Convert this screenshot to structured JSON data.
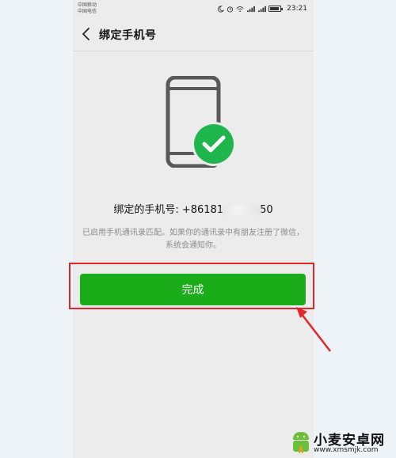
{
  "status_bar": {
    "carrier_1": "中国移动",
    "carrier_2": "中国电信",
    "time": "23:21"
  },
  "nav": {
    "title": "绑定手机号"
  },
  "main": {
    "phone_label": "绑定的手机号: +86181",
    "phone_suffix": "50",
    "description": "已启用手机通讯录匹配。如果你的通讯录中有朋友注册了微信，系统会通知你。",
    "done_label": "完成"
  },
  "watermark": {
    "name": "小麦安卓网",
    "url": "www.xmsmjk.com"
  },
  "colors": {
    "accent_green": "#1aad19",
    "check_green": "#1fb64d",
    "highlight_red": "#e3262b"
  },
  "icons": {
    "back": "chevron-left-icon",
    "moon": "moon-icon",
    "alarm": "alarm-icon",
    "wifi": "wifi-icon",
    "signal": "signal-icon",
    "battery": "battery-icon",
    "check": "check-icon"
  }
}
